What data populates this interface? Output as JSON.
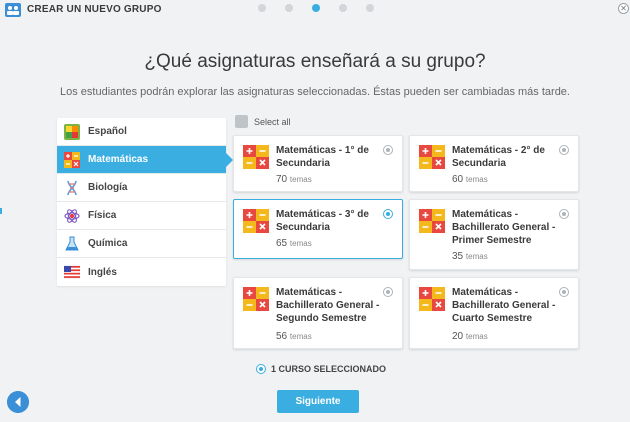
{
  "header": {
    "title": "CREAR UN NUEVO GRUPO",
    "app_icon": "group-icon",
    "close_icon": "close-icon",
    "steps_total": 5,
    "current_step": 3
  },
  "main": {
    "heading": "¿Qué asignaturas enseñará a su grupo?",
    "subheading": "Los estudiantes podrán explorar las asignaturas seleccionadas. Éstas pueden ser cambiadas más tarde.",
    "select_all_label": "Select all"
  },
  "sidebar": {
    "items": [
      {
        "label": "Español",
        "icon": "abc-book-icon"
      },
      {
        "label": "Matemáticas",
        "icon": "math-operators-icon"
      },
      {
        "label": "Biología",
        "icon": "dna-icon"
      },
      {
        "label": "Física",
        "icon": "atom-icon"
      },
      {
        "label": "Química",
        "icon": "flask-icon"
      },
      {
        "label": "Inglés",
        "icon": "us-flag-icon"
      }
    ],
    "active_index": 1
  },
  "courses": [
    {
      "title": "Matemáticas - 1° de Secundaria",
      "count": "70",
      "unit": "temas",
      "selected": false
    },
    {
      "title": "Matemáticas - 2° de Secundaria",
      "count": "60",
      "unit": "temas",
      "selected": false
    },
    {
      "title": "Matemáticas - 3° de Secundaria",
      "count": "65",
      "unit": "temas",
      "selected": true
    },
    {
      "title": "Matemáticas - Bachillerato General - Primer Semestre",
      "count": "35",
      "unit": "temas",
      "selected": false
    },
    {
      "title": "Matemáticas - Bachillerato General - Segundo Semestre",
      "count": "56",
      "unit": "temas",
      "selected": false
    },
    {
      "title": "Matemáticas - Bachillerato General - Cuarto Semestre",
      "count": "20",
      "unit": "temas",
      "selected": false
    }
  ],
  "footer": {
    "selected_count_label": "1 CURSO SELECCIONADO",
    "next_label": "Siguiente",
    "back_icon": "arrow-left-icon"
  },
  "colors": {
    "accent": "#3aaee0",
    "math_red": "#e8483f",
    "math_yellow": "#f2b81c"
  }
}
